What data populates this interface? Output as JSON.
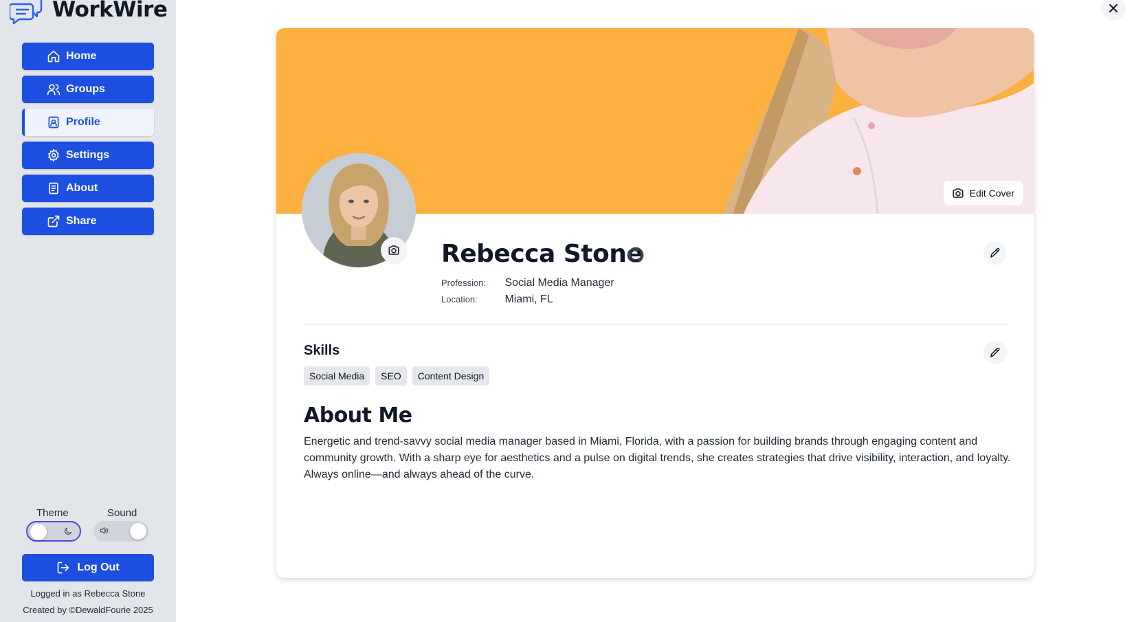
{
  "app": {
    "name": "WorkWire"
  },
  "sidebar": {
    "items": [
      {
        "label": "Home",
        "icon": "home-icon"
      },
      {
        "label": "Groups",
        "icon": "users-icon"
      },
      {
        "label": "Profile",
        "icon": "profile-card-icon",
        "active": true
      },
      {
        "label": "Settings",
        "icon": "gear-icon"
      },
      {
        "label": "About",
        "icon": "document-icon"
      },
      {
        "label": "Share",
        "icon": "external-link-icon"
      }
    ],
    "theme_label": "Theme",
    "sound_label": "Sound",
    "logout_label": "Log Out",
    "logged_in_text": "Logged in as Rebecca Stone",
    "credit_text": "Created by ©DewaldFourie 2025"
  },
  "profile": {
    "edit_cover_label": "Edit Cover",
    "name": "Rebecca Stone",
    "profession_key": "Profession:",
    "profession_value": "Social Media Manager",
    "location_key": "Location:",
    "location_value": "Miami, FL",
    "skills_heading": "Skills",
    "skills": [
      "Social Media",
      "SEO",
      "Content Design"
    ],
    "about_heading": "About Me",
    "about_text": "Energetic and trend-savvy social media manager based in Miami, Florida, with a passion for building brands through engaging content and community growth. With a sharp eye for aesthetics and a pulse on digital trends, she creates strategies that drive visibility, interaction, and loyalty. Always online—and always ahead of the curve."
  },
  "colors": {
    "accent": "#1d4fe0",
    "cover": "#fbb040",
    "sidebar_bg": "#e2e5ea"
  }
}
